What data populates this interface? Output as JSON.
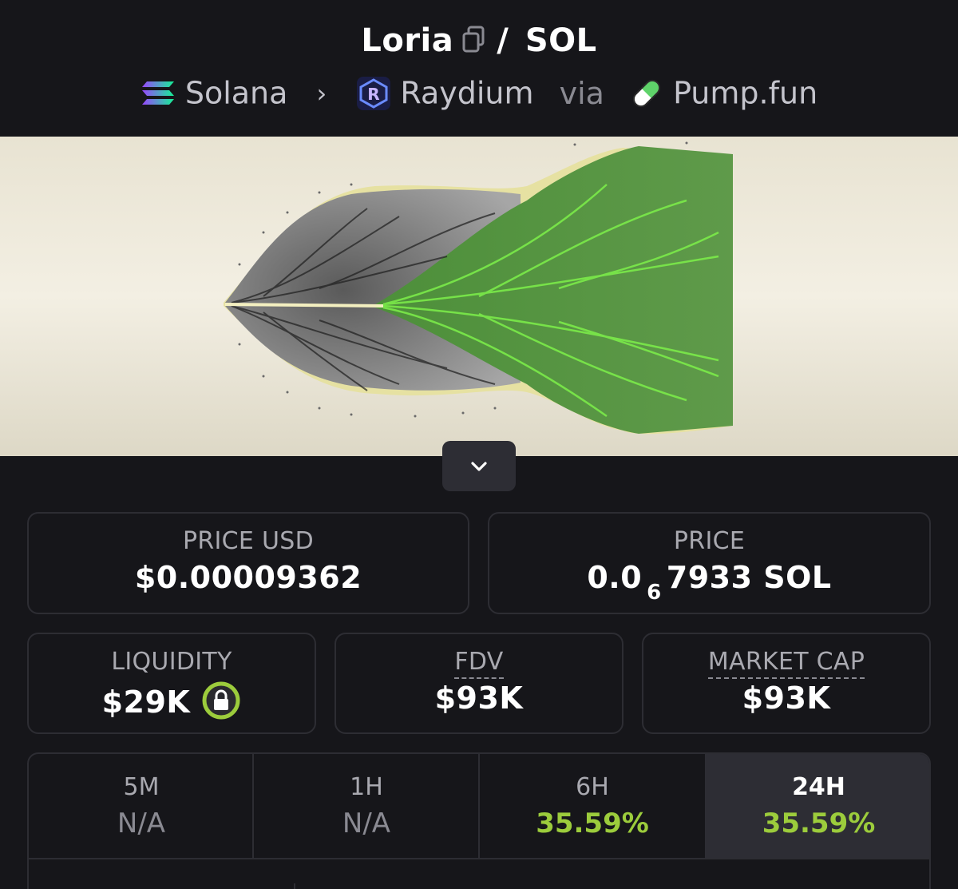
{
  "header": {
    "token": "Loria",
    "pair_sep": "/",
    "quote": "SOL",
    "chain": "Solana",
    "dex": "Raydium",
    "via_label": "via",
    "launchpad": "Pump.fun"
  },
  "stats": {
    "price_usd_label": "PRICE USD",
    "price_usd_value": "$0.00009362",
    "price_label": "PRICE",
    "price_prefix": "0.0",
    "price_subscript": "6",
    "price_suffix": "7933 SOL",
    "liquidity_label": "LIQUIDITY",
    "liquidity_value": "$29K",
    "fdv_label": "FDV",
    "fdv_value": "$93K",
    "mcap_label": "MARKET CAP",
    "mcap_value": "$93K"
  },
  "timeframes": [
    {
      "label": "5M",
      "value": "N/A"
    },
    {
      "label": "1H",
      "value": "N/A"
    },
    {
      "label": "6H",
      "value": "35.59%"
    },
    {
      "label": "24H",
      "value": "35.59%"
    }
  ],
  "colors": {
    "background": "#16161a",
    "card_border": "#2d2d33",
    "positive": "#9ccc3c",
    "lock_ring": "#9ccc3c"
  },
  "icons": {
    "copy": "copy-icon",
    "solana": "solana-logo-icon",
    "raydium": "raydium-logo-icon",
    "pumpfun": "pill-icon",
    "expand": "chevron-down-icon",
    "lock": "lock-icon"
  }
}
